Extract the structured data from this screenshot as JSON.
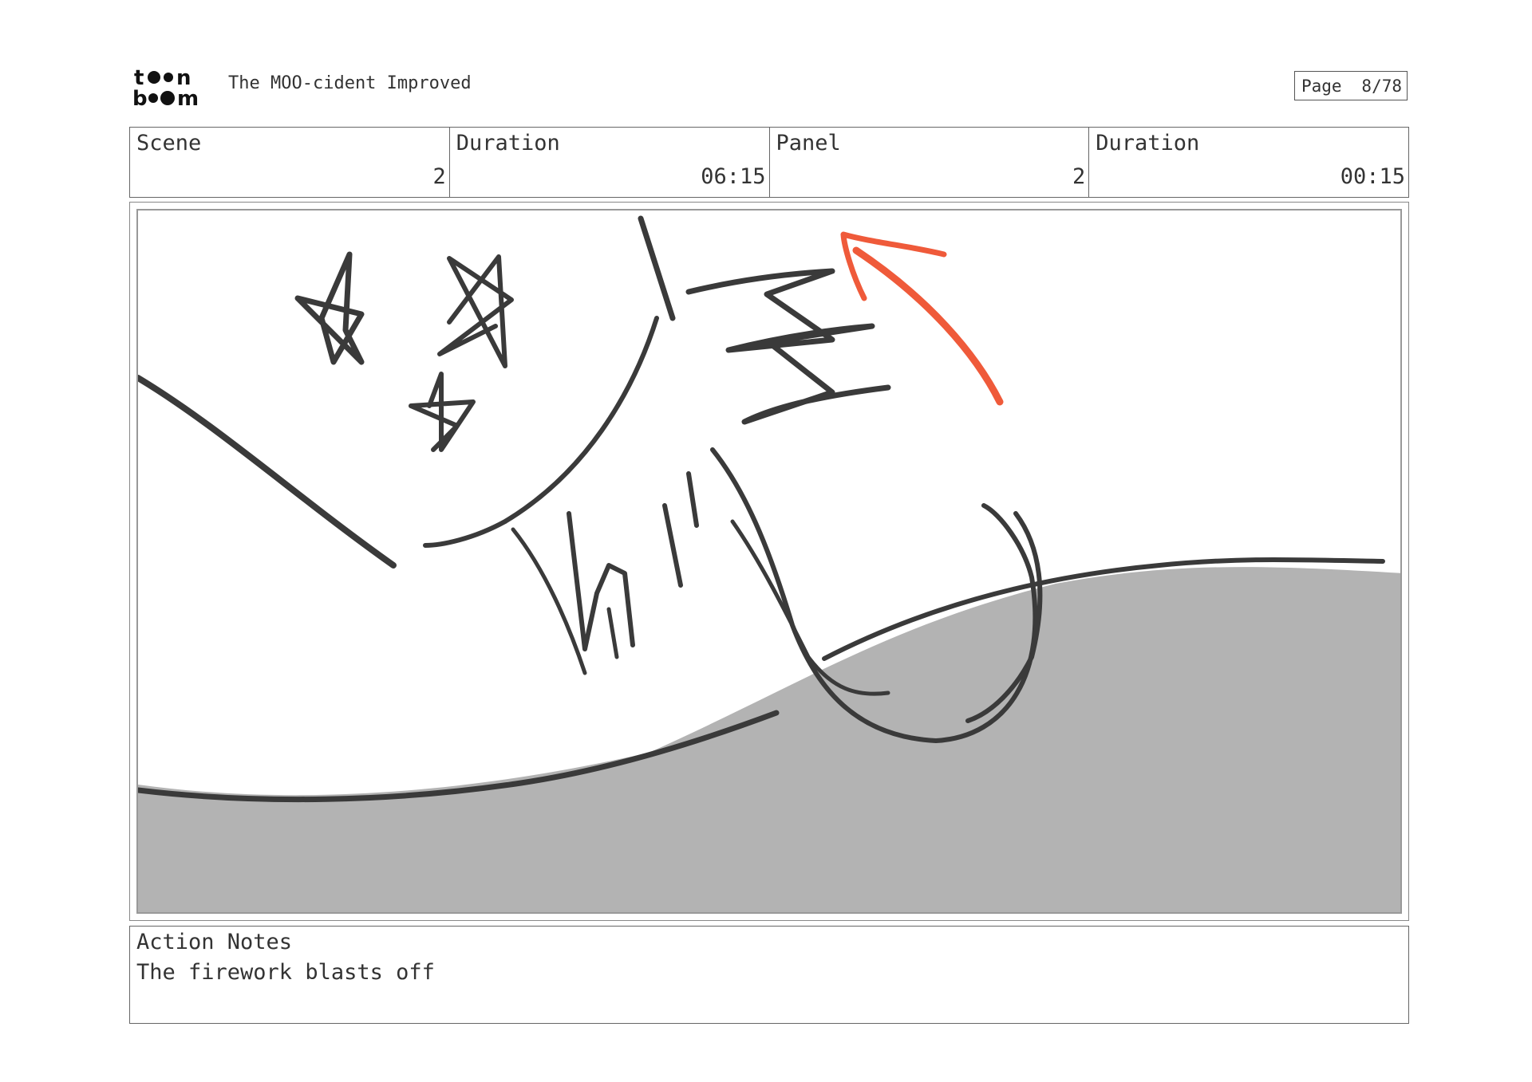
{
  "header": {
    "logo_text": "toon boom",
    "document_title": "The MOO-cident Improved",
    "page_label": "Page",
    "page_number": "8/78"
  },
  "info": {
    "scene_label": "Scene",
    "scene_value": "2",
    "scene_duration_label": "Duration",
    "scene_duration_value": "06:15",
    "panel_label": "Panel",
    "panel_value": "2",
    "panel_duration_label": "Duration",
    "panel_duration_value": "00:15"
  },
  "notes": {
    "label": "Action Notes",
    "text": "The firework blasts off"
  },
  "colors": {
    "ink": "#3a3a3a",
    "ground": "#b3b3b3",
    "arrow": "#ef5a3a",
    "border": "#666666"
  }
}
